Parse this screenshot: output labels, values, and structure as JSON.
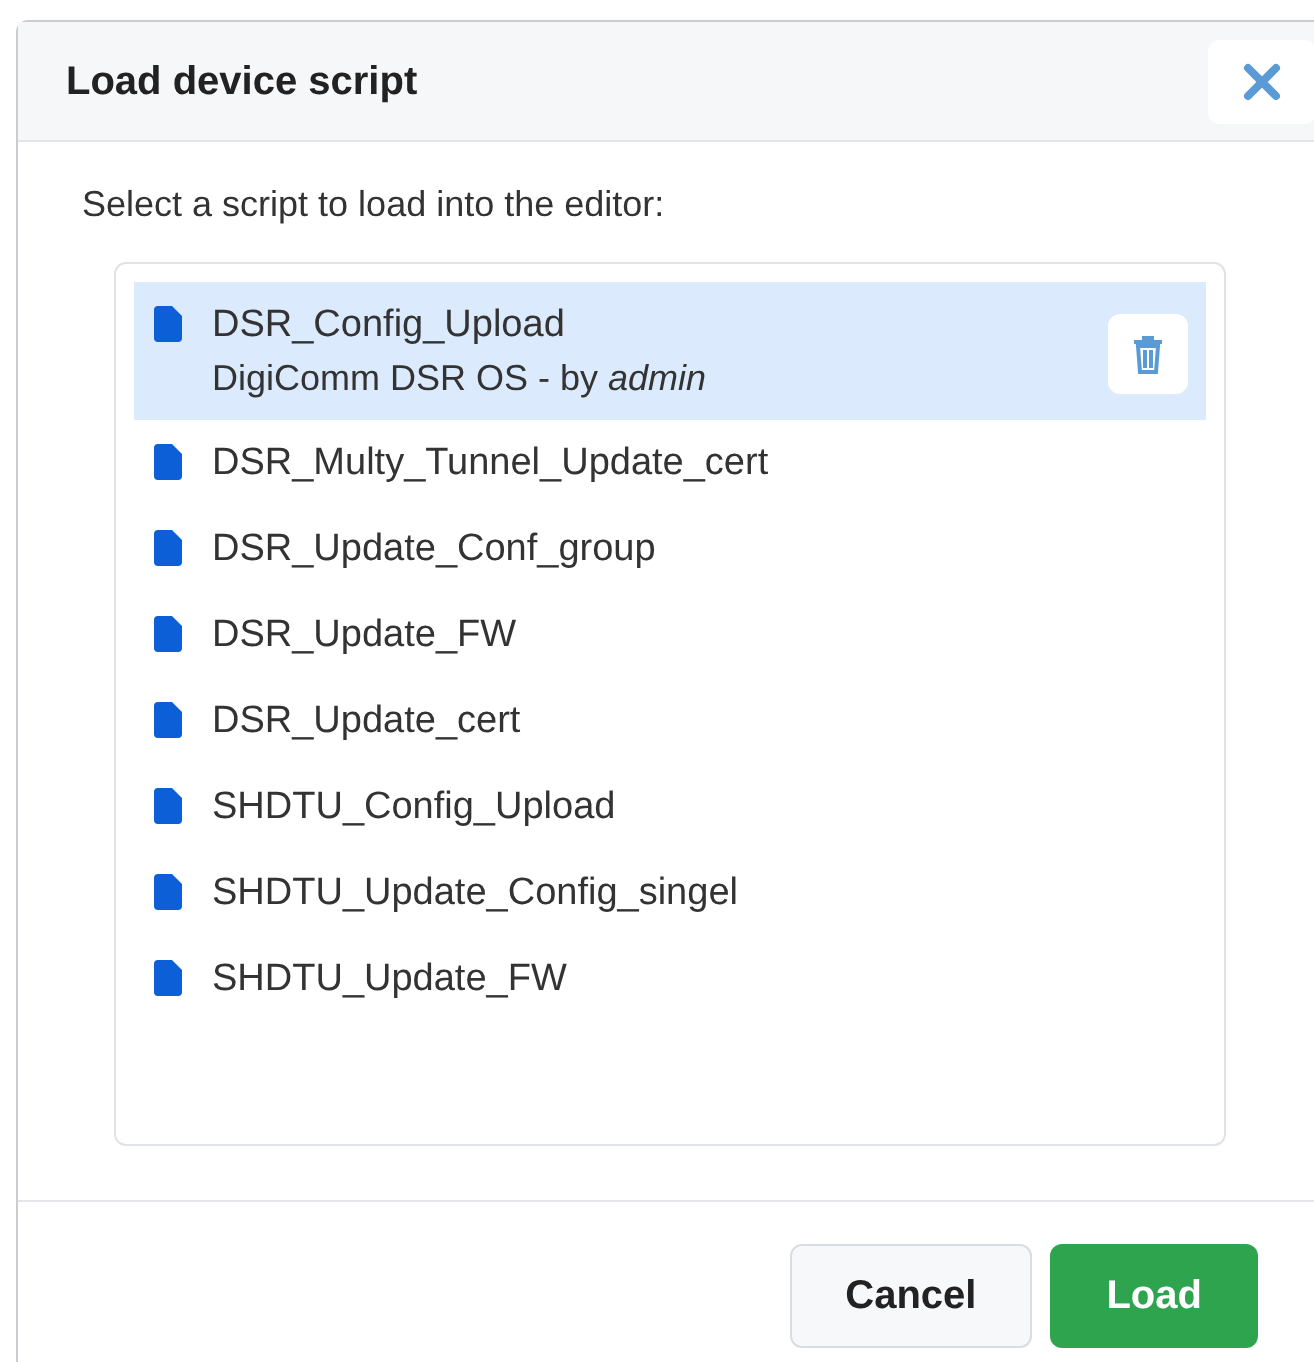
{
  "dialog": {
    "title": "Load device script",
    "prompt": "Select a script to load into the editor:",
    "scripts": [
      {
        "name": "DSR_Config_Upload",
        "subtitle": "DigiComm DSR OS - by *admin*",
        "selected": true
      },
      {
        "name": "DSR_Multy_Tunnel_Update_cert",
        "selected": false
      },
      {
        "name": "DSR_Update_Conf_group",
        "selected": false
      },
      {
        "name": "DSR_Update_FW",
        "selected": false
      },
      {
        "name": "DSR_Update_cert",
        "selected": false
      },
      {
        "name": "SHDTU_Config_Upload",
        "selected": false
      },
      {
        "name": "SHDTU_Update_Config_singel",
        "selected": false
      },
      {
        "name": "SHDTU_Update_FW",
        "selected": false
      }
    ],
    "buttons": [
      {
        "label": "Cancel",
        "kind": "secondary"
      },
      {
        "label": "Load",
        "kind": "primary"
      }
    ]
  }
}
